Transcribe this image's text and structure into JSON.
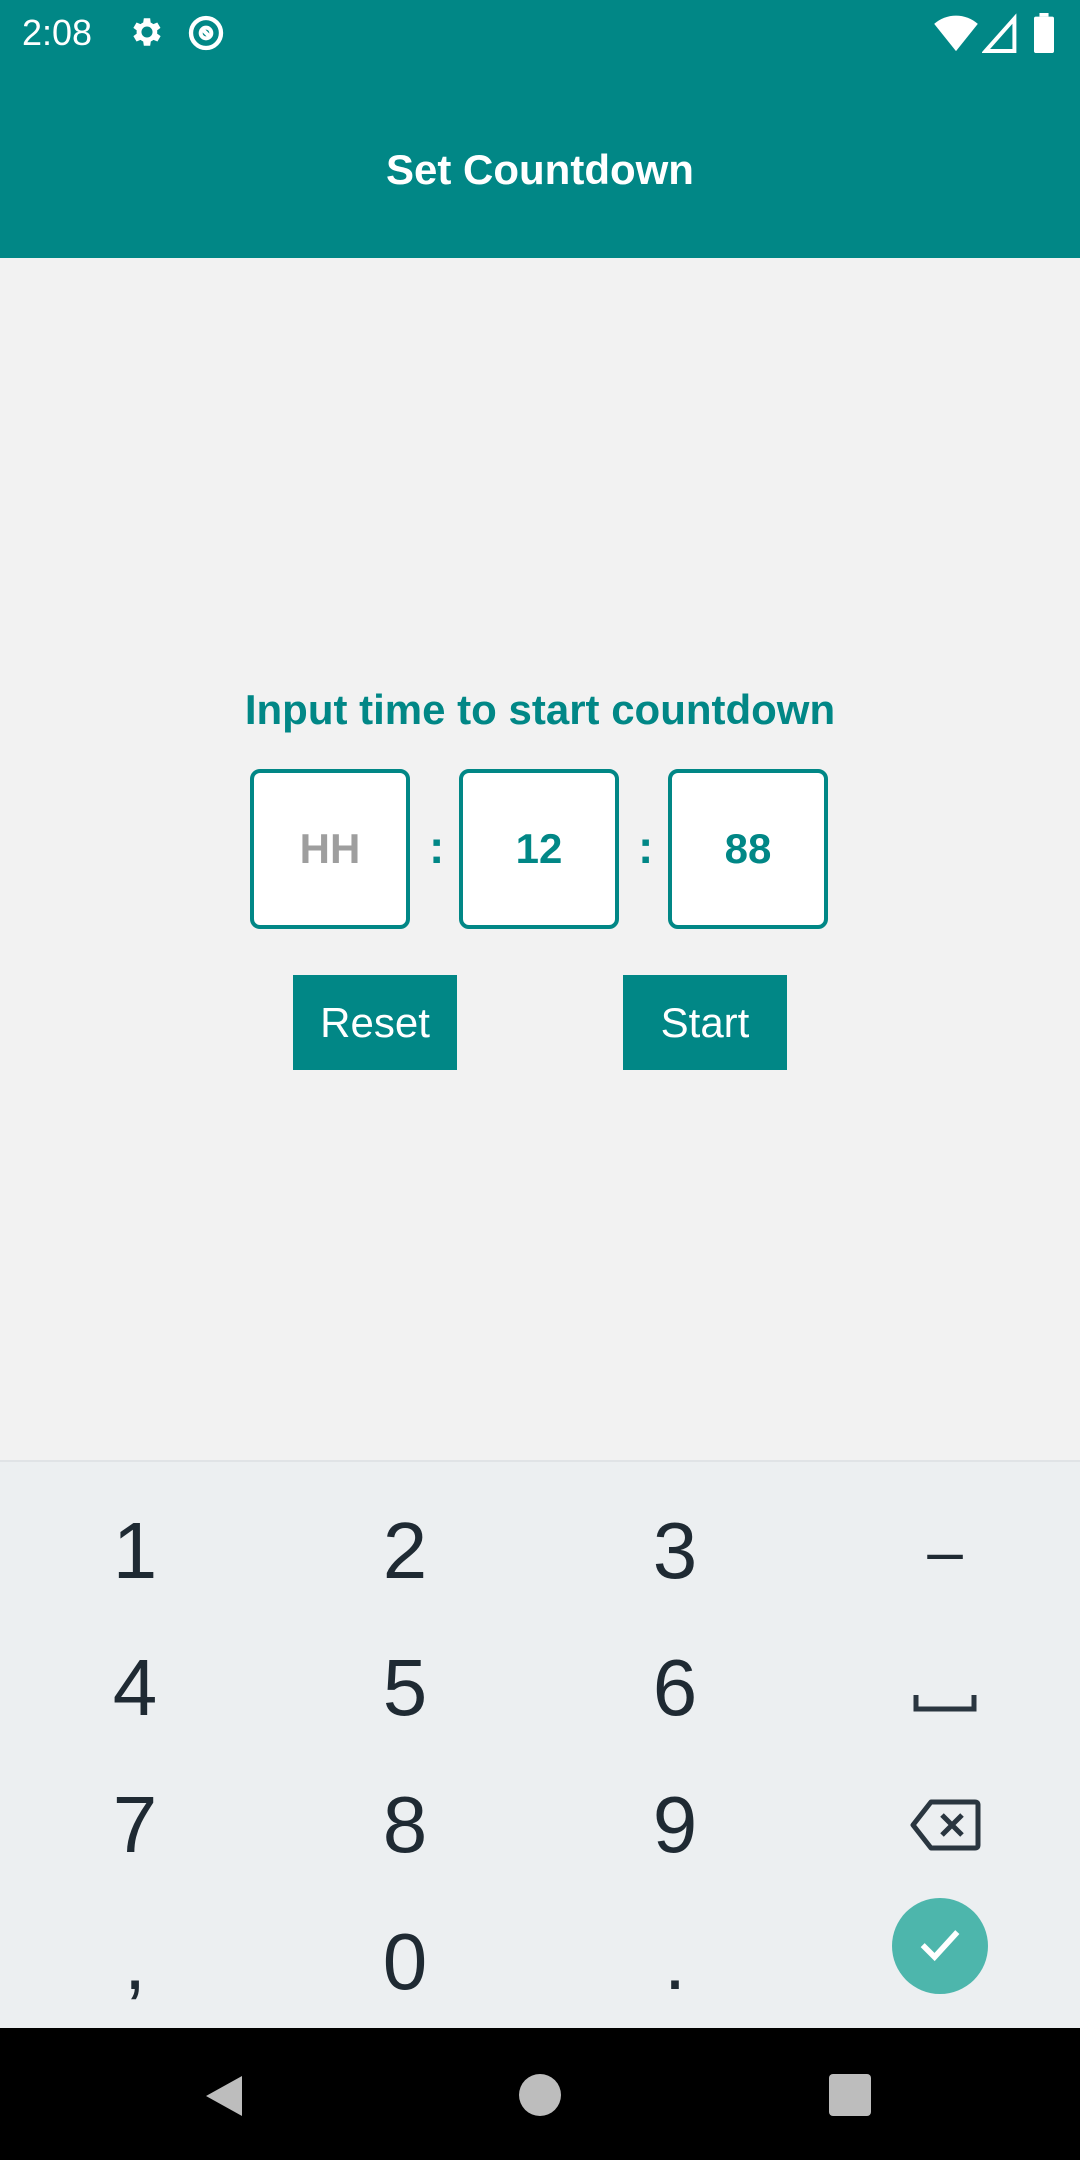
{
  "status_bar": {
    "time": "2:08",
    "icons": [
      "gear-icon",
      "at-icon",
      "wifi-icon",
      "signal-icon",
      "battery-icon"
    ]
  },
  "app_bar": {
    "title": "Set Countdown"
  },
  "main": {
    "prompt": "Input time to start countdown",
    "hours": {
      "value": "",
      "placeholder": "HH"
    },
    "minutes": {
      "value": "12"
    },
    "seconds": {
      "value": "88"
    },
    "separator": ":",
    "reset_label": "Reset",
    "start_label": "Start"
  },
  "keyboard": {
    "rows": [
      [
        "1",
        "2",
        "3",
        "–"
      ],
      [
        "4",
        "5",
        "6",
        "␣"
      ],
      [
        "7",
        "8",
        "9",
        "⌫"
      ],
      [
        ",",
        "0",
        ".",
        "✓"
      ]
    ]
  },
  "nav": {
    "icons": [
      "back-icon",
      "home-icon",
      "recents-icon"
    ]
  },
  "colors": {
    "primary": "#018786",
    "accent": "#4db6ac",
    "background": "#f2f2f2"
  }
}
